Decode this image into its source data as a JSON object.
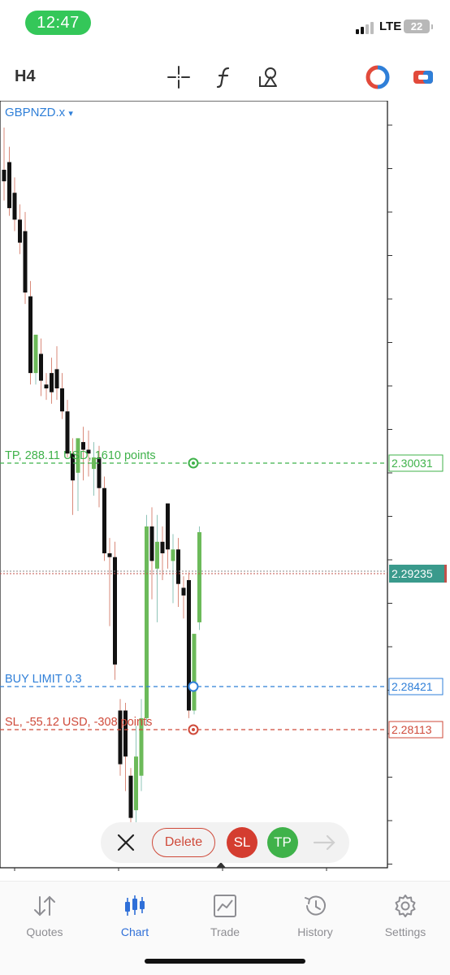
{
  "status_bar": {
    "time": "12:47",
    "network": "LTE",
    "battery": "22"
  },
  "toolbar": {
    "timeframe": "H4",
    "tools": [
      "crosshair-icon",
      "function-icon",
      "objects-icon",
      "one-click-trading-icon",
      "switch-icon"
    ]
  },
  "chart": {
    "symbol": "GBPNZD.x",
    "symbol_caret": "▾",
    "colors": {
      "bull": "#6cba5a",
      "bear": "#111111",
      "tp": "#3fb24a",
      "sl": "#cf4a3a",
      "buy": "#2f7fd8",
      "bid": "#3a9a8c"
    },
    "current_price": "2.29235",
    "tp_line": {
      "label": "TP, 288.11 USD, 1610 points",
      "price": "2.30031"
    },
    "buy_limit": {
      "label": "BUY LIMIT 0.3",
      "price": "2.28421"
    },
    "sl_line": {
      "label": "SL, -55.12 USD, -308 points",
      "price": "2.28113"
    }
  },
  "chart_data": {
    "type": "candlestick",
    "symbol": "GBPNZD.x",
    "timeframe": "H4",
    "ylim": [
      2.276,
      2.316
    ],
    "candles": [
      {
        "o": 2.3124,
        "h": 2.3146,
        "l": 2.3108,
        "c": 2.3118
      },
      {
        "o": 2.3128,
        "h": 2.3136,
        "l": 2.31,
        "c": 2.3104
      },
      {
        "o": 2.3112,
        "h": 2.312,
        "l": 2.3092,
        "c": 2.3098
      },
      {
        "o": 2.3098,
        "h": 2.3106,
        "l": 2.308,
        "c": 2.3086
      },
      {
        "o": 2.3092,
        "h": 2.3102,
        "l": 2.3054,
        "c": 2.306
      },
      {
        "o": 2.3058,
        "h": 2.3066,
        "l": 2.3012,
        "c": 2.3018
      },
      {
        "o": 2.3018,
        "h": 2.3028,
        "l": 2.3012,
        "c": 2.3038
      },
      {
        "o": 2.3028,
        "h": 2.3036,
        "l": 2.3006,
        "c": 2.3014
      },
      {
        "o": 2.3012,
        "h": 2.3018,
        "l": 2.3004,
        "c": 2.301
      },
      {
        "o": 2.3018,
        "h": 2.3026,
        "l": 2.3002,
        "c": 2.3008
      },
      {
        "o": 2.302,
        "h": 2.3032,
        "l": 2.3004,
        "c": 2.301
      },
      {
        "o": 2.301,
        "h": 2.3018,
        "l": 2.2994,
        "c": 2.2998
      },
      {
        "o": 2.2998,
        "h": 2.3004,
        "l": 2.2974,
        "c": 2.2976
      },
      {
        "o": 2.2976,
        "h": 2.2984,
        "l": 2.2944,
        "c": 2.2962
      },
      {
        "o": 2.2966,
        "h": 2.2978,
        "l": 2.2946,
        "c": 2.2984
      },
      {
        "o": 2.2982,
        "h": 2.299,
        "l": 2.2962,
        "c": 2.2978
      },
      {
        "o": 2.2978,
        "h": 2.2988,
        "l": 2.2964,
        "c": 2.2976
      },
      {
        "o": 2.2968,
        "h": 2.2982,
        "l": 2.2954,
        "c": 2.2974
      },
      {
        "o": 2.2974,
        "h": 2.298,
        "l": 2.2948,
        "c": 2.2958
      },
      {
        "o": 2.2958,
        "h": 2.2964,
        "l": 2.292,
        "c": 2.2924
      },
      {
        "o": 2.2924,
        "h": 2.2932,
        "l": 2.2886,
        "c": 2.2922
      },
      {
        "o": 2.2922,
        "h": 2.293,
        "l": 2.2858,
        "c": 2.2866
      },
      {
        "o": 2.2842,
        "h": 2.2848,
        "l": 2.2808,
        "c": 2.2814
      },
      {
        "o": 2.2842,
        "h": 2.2846,
        "l": 2.28,
        "c": 2.2818
      },
      {
        "o": 2.2808,
        "h": 2.2812,
        "l": 2.278,
        "c": 2.2786
      },
      {
        "o": 2.279,
        "h": 2.2834,
        "l": 2.2774,
        "c": 2.2818
      },
      {
        "o": 2.2808,
        "h": 2.2848,
        "l": 2.28,
        "c": 2.2838
      },
      {
        "o": 2.2838,
        "h": 2.2944,
        "l": 2.2834,
        "c": 2.2938
      },
      {
        "o": 2.2938,
        "h": 2.2948,
        "l": 2.29,
        "c": 2.292
      },
      {
        "o": 2.2916,
        "h": 2.2944,
        "l": 2.2888,
        "c": 2.293
      },
      {
        "o": 2.293,
        "h": 2.2938,
        "l": 2.291,
        "c": 2.2924
      },
      {
        "o": 2.295,
        "h": 2.295,
        "l": 2.2916,
        "c": 2.2926
      },
      {
        "o": 2.292,
        "h": 2.2934,
        "l": 2.2898,
        "c": 2.2926
      },
      {
        "o": 2.2926,
        "h": 2.2932,
        "l": 2.2896,
        "c": 2.2908
      },
      {
        "o": 2.2906,
        "h": 2.2912,
        "l": 2.289,
        "c": 2.2902
      },
      {
        "o": 2.291,
        "h": 2.2914,
        "l": 2.2838,
        "c": 2.2842
      },
      {
        "o": 2.2842,
        "h": 2.288,
        "l": 2.284,
        "c": 2.2882
      },
      {
        "o": 2.2888,
        "h": 2.2938,
        "l": 2.2884,
        "c": 2.2935
      }
    ]
  },
  "action_bar": {
    "delete_label": "Delete",
    "sl_label": "SL",
    "tp_label": "TP"
  },
  "tab_bar": {
    "tabs": [
      {
        "label": "Quotes",
        "icon": "quotes-icon"
      },
      {
        "label": "Chart",
        "icon": "chart-icon",
        "active": true
      },
      {
        "label": "Trade",
        "icon": "trade-icon"
      },
      {
        "label": "History",
        "icon": "history-icon"
      },
      {
        "label": "Settings",
        "icon": "settings-icon"
      }
    ]
  }
}
